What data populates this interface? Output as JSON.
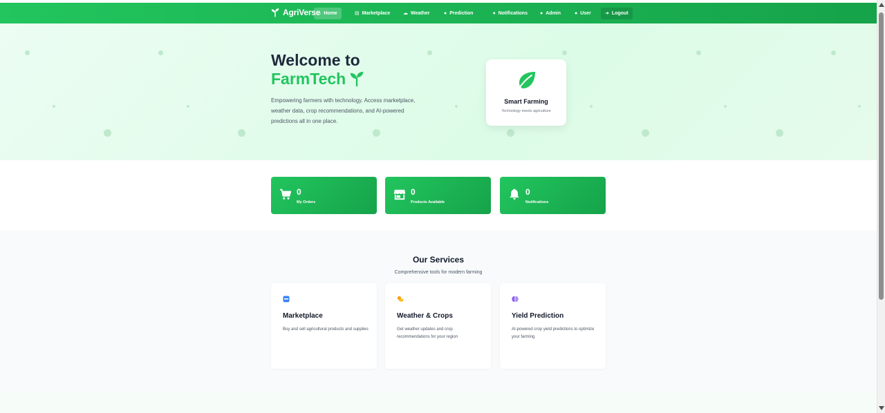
{
  "navbar": {
    "brand": "AgriVerse",
    "items": [
      {
        "label": "Home",
        "icon": "home-icon"
      },
      {
        "label": "Marketplace",
        "icon": "store-icon"
      },
      {
        "label": "Weather",
        "icon": "cloud-sun-icon"
      },
      {
        "label": "Prediction",
        "icon": "brain-icon"
      },
      {
        "label": "Notifications",
        "icon": "bell-icon"
      },
      {
        "label": "Admin",
        "icon": "users-icon"
      },
      {
        "label": "User",
        "icon": "user-icon"
      },
      {
        "label": "Logout",
        "icon": "logout-icon"
      }
    ],
    "active": "Home"
  },
  "hero": {
    "title_line1": "Welcome to",
    "title_line2": "FarmTech",
    "description": "Empowering farmers with technology. Access marketplace, weather data, crop recommendations, and AI-powered predictions all in one place.",
    "card": {
      "title": "Smart Farming",
      "subtitle": "Technology meets agriculture",
      "icon": "leaf-icon"
    }
  },
  "stats": [
    {
      "value": "0",
      "label": "My Orders",
      "icon": "cart-icon"
    },
    {
      "value": "0",
      "label": "Products Available",
      "icon": "store-icon"
    },
    {
      "value": "0",
      "label": "Notifications",
      "icon": "bell-icon"
    }
  ],
  "services": {
    "title": "Our Services",
    "subtitle": "Comprehensive tools for modern farming",
    "cards": [
      {
        "title": "Marketplace",
        "description": "Buy and sell agricultural products and supplies",
        "icon": "store-icon",
        "icon_color": "#3b82f6"
      },
      {
        "title": "Weather & Crops",
        "description": "Get weather updates and crop recommendations for your region",
        "icon": "cloud-sun-icon",
        "icon_color": "#f59e0b"
      },
      {
        "title": "Yield Prediction",
        "description": "AI-powered crop yield predictions to optimize your farming",
        "icon": "brain-icon",
        "icon_color": "#8b5cf6"
      }
    ]
  },
  "colors": {
    "primary": "#22c55e",
    "primary_dark": "#16a34a",
    "heading": "#1e293b"
  }
}
